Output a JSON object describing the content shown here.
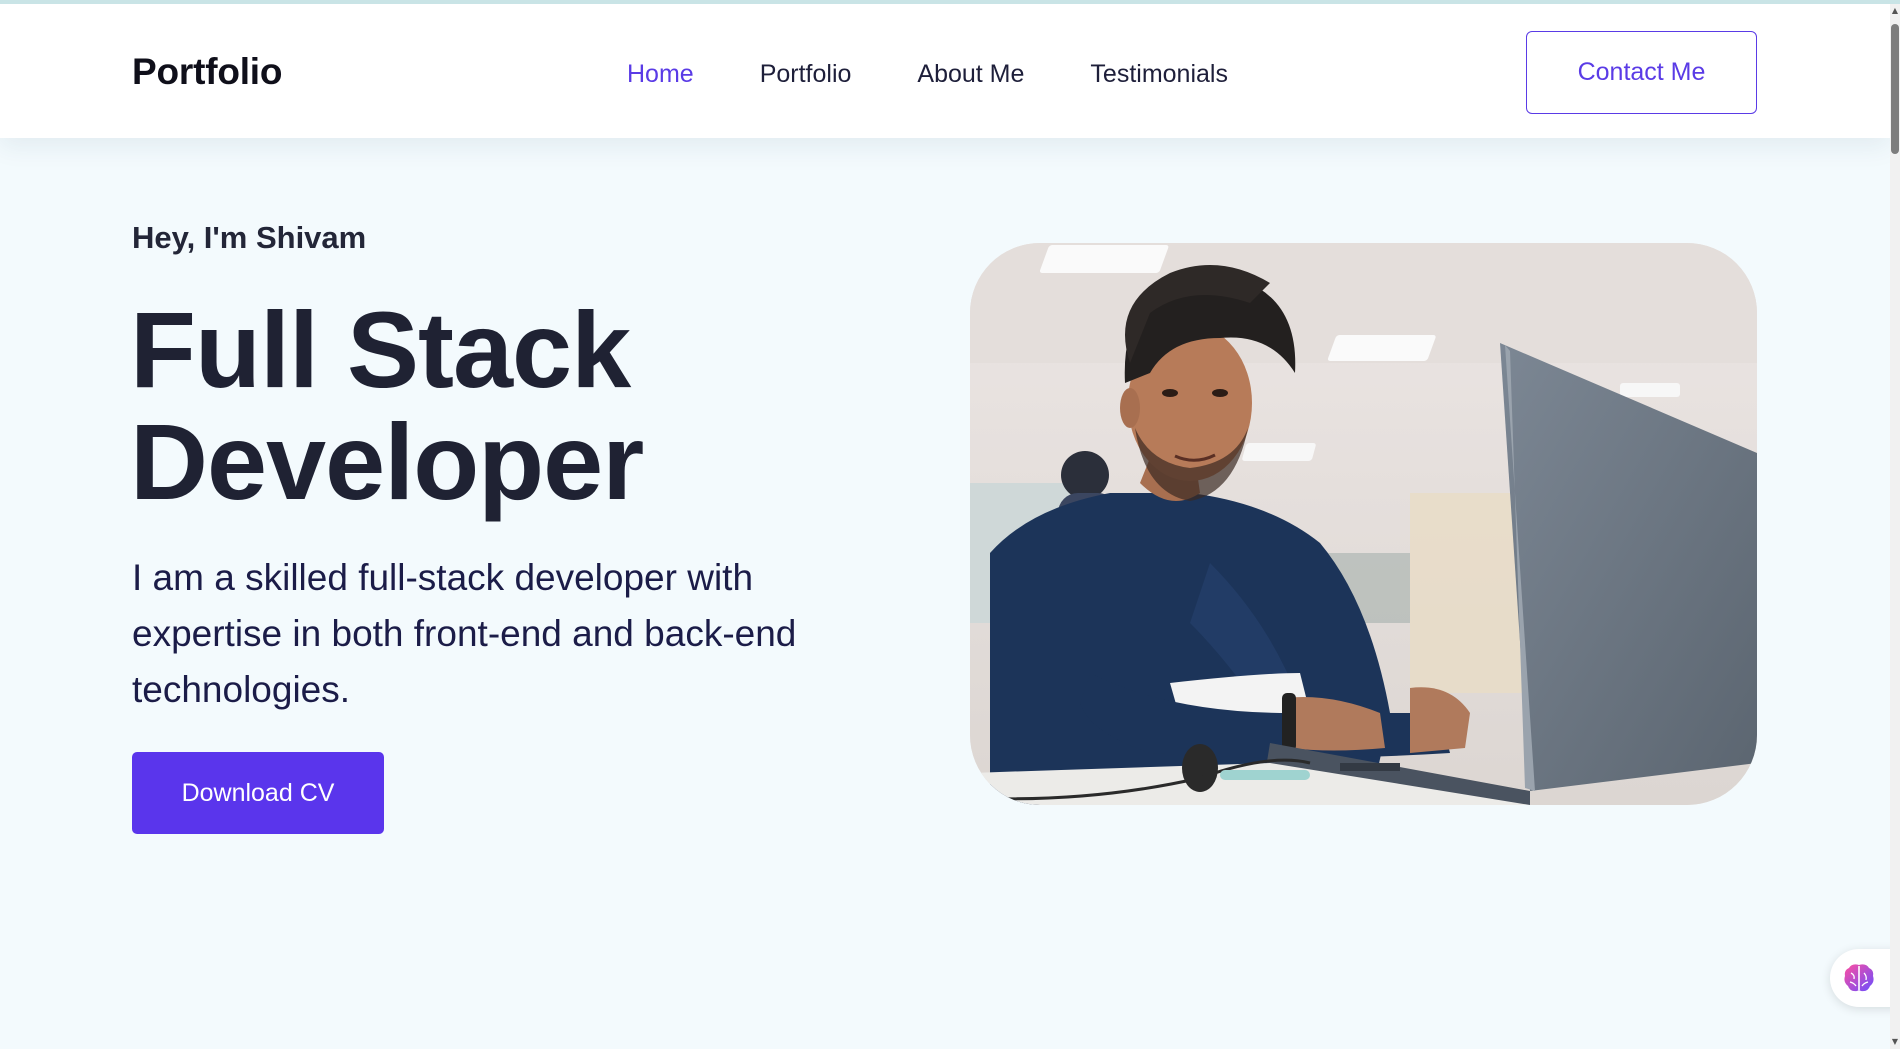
{
  "nav": {
    "brand": "Portfolio",
    "links": [
      {
        "label": "Home",
        "active": true
      },
      {
        "label": "Portfolio",
        "active": false
      },
      {
        "label": "About Me",
        "active": false
      },
      {
        "label": "Testimonials",
        "active": false
      }
    ],
    "contact_label": "Contact Me"
  },
  "hero": {
    "greeting": "Hey, I'm Shivam",
    "headline_line1": "Full Stack",
    "headline_line2": "Developer",
    "intro": "I am a skilled full-stack developer with expertise in both front-end and back-end technologies.",
    "cv_label": "Download CV"
  },
  "icons": {
    "widget": "brain-icon",
    "scroll_up": "chevron-up-icon",
    "scroll_down": "chevron-down-icon"
  },
  "colors": {
    "accent": "#5a35ec",
    "text_dark": "#1f2233",
    "page_bg": "#f3fafd"
  }
}
